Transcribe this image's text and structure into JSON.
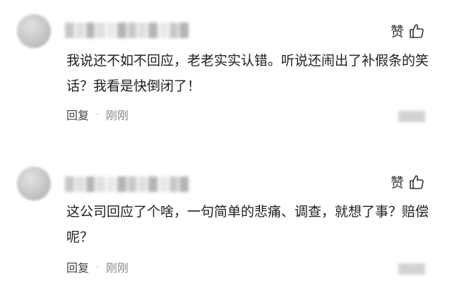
{
  "comments": [
    {
      "like_label": "赞",
      "text": "我说还不如不回应，老老实实认错。听说还闹出了补假条的笑话？我看是快倒闭了！",
      "reply_label": "回复",
      "separator": "·",
      "time": "刚刚"
    },
    {
      "like_label": "赞",
      "text": "这公司回应了个啥，一句简单的悲痛、调查，就想了事？赔偿呢？",
      "reply_label": "回复",
      "separator": "·",
      "time": "刚刚"
    }
  ]
}
